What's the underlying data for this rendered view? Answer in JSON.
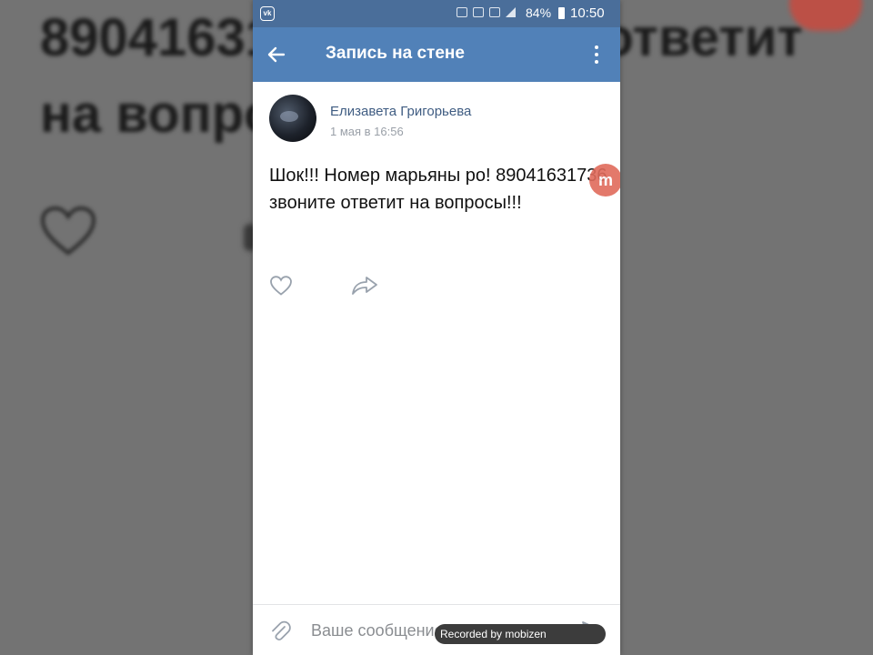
{
  "background": {
    "line1": "89041631736 звоните ответит",
    "line2": "на вопросы!!!"
  },
  "status_bar": {
    "app_glyph": "vk",
    "battery": "84%",
    "time": "10:50"
  },
  "app_bar": {
    "title": "Запись на стене",
    "back_icon": "arrow-left-icon",
    "menu_icon": "more-vertical-icon"
  },
  "post": {
    "author": "Елизавета Григорьева",
    "date": "1 мая в 16:56",
    "text": "Шок!!! Номер марьяны ро! 89041631736 звоните ответит на вопросы!!!",
    "badge": "m",
    "actions": {
      "like_icon": "heart-icon",
      "share_icon": "share-arrow-icon"
    }
  },
  "composer": {
    "placeholder": "Ваше сообщение",
    "attach_icon": "paperclip-icon",
    "send_icon": "send-icon"
  },
  "watermark": {
    "text": "Recorded by mobizen"
  },
  "colors": {
    "header": "#5181b8",
    "status_bar": "#4a6e9a",
    "author_link": "#3f5c82",
    "card": "#ffffff"
  }
}
